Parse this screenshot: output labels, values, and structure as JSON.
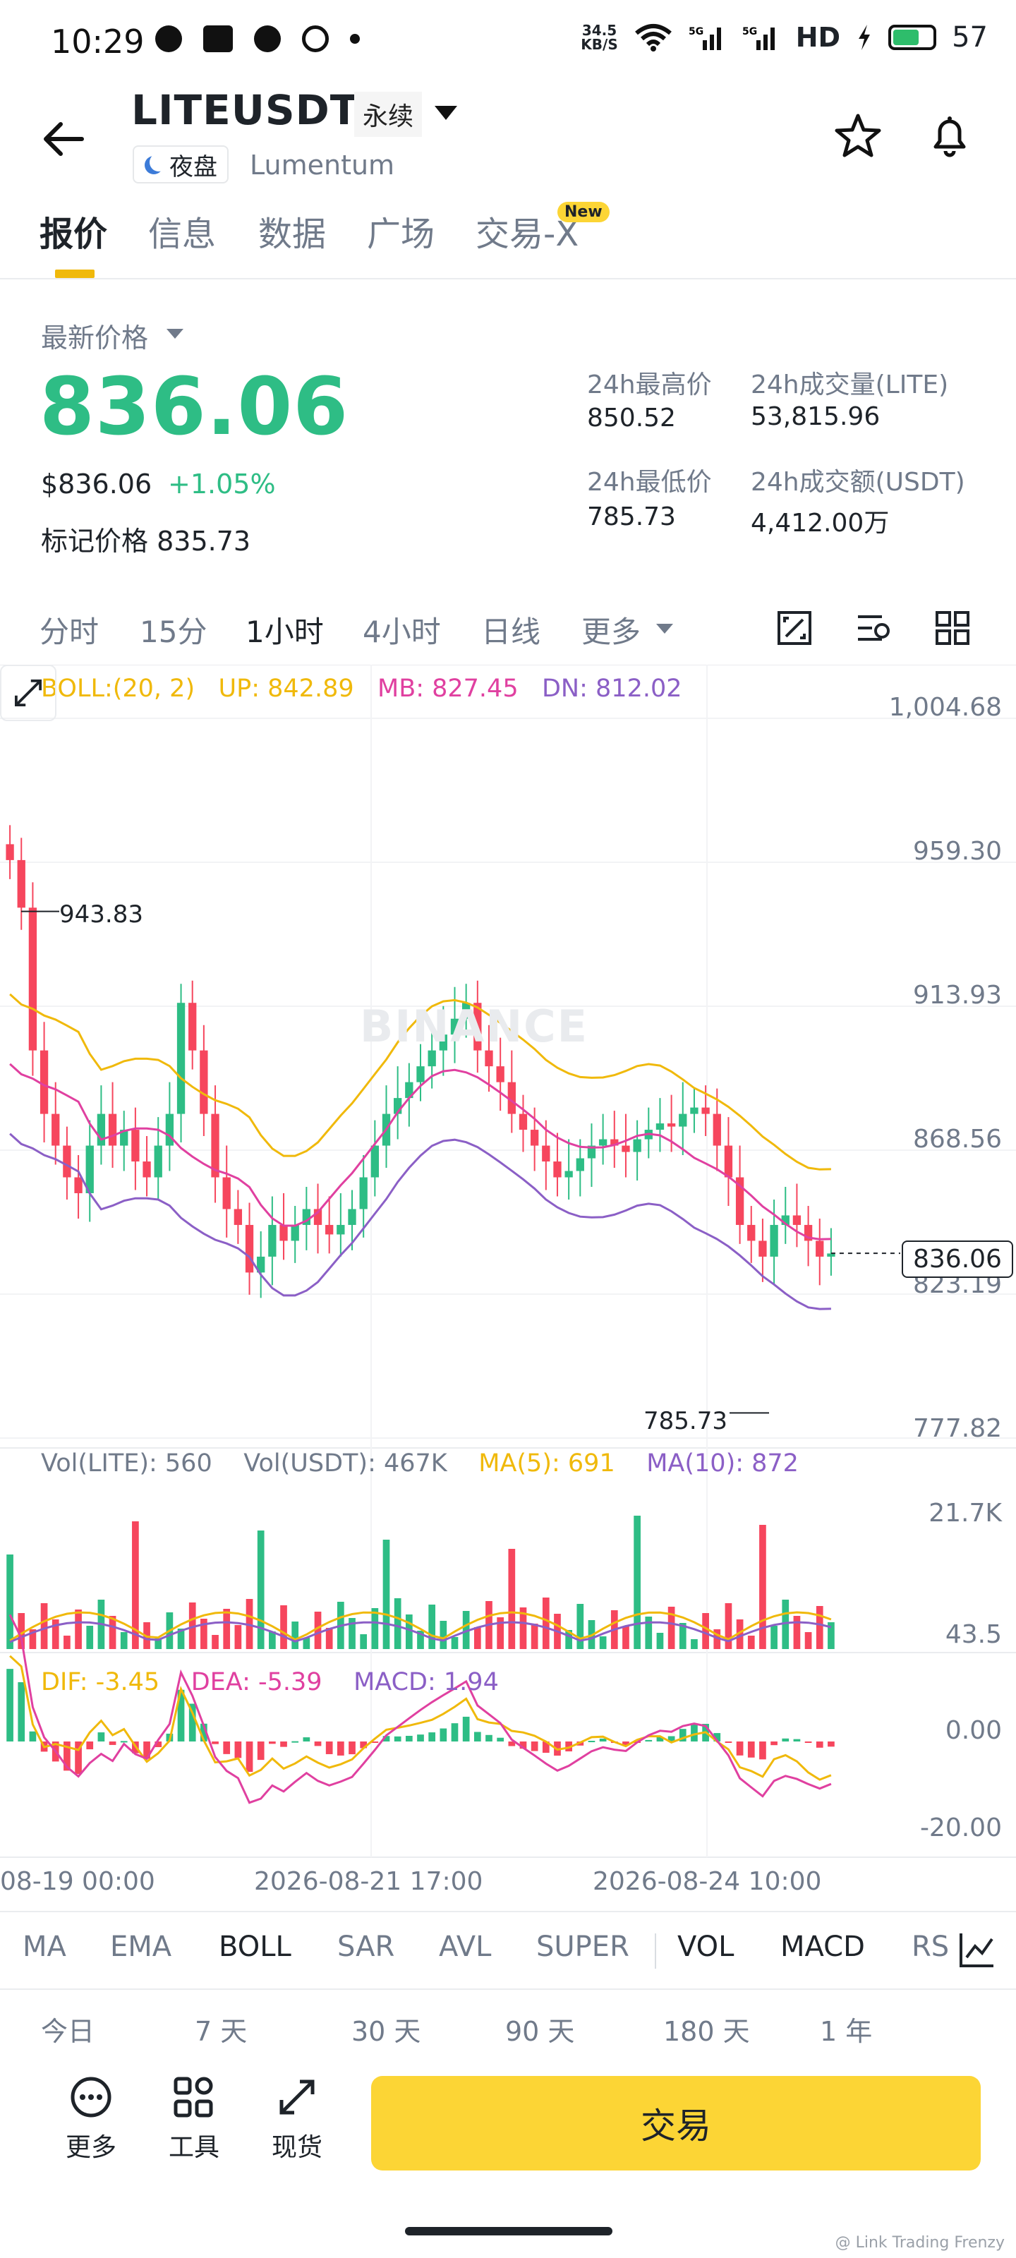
{
  "status_bar": {
    "time": "10:29",
    "net_speed_top": "34.5",
    "net_speed_unit": "KB/S",
    "battery": "57"
  },
  "header": {
    "symbol": "LITEUSDT",
    "contract_type": "永续",
    "session_tag": "夜盘",
    "company": "Lumentum"
  },
  "tabs": [
    {
      "label": "报价",
      "active": true
    },
    {
      "label": "信息",
      "active": false
    },
    {
      "label": "数据",
      "active": false
    },
    {
      "label": "广场",
      "active": false
    },
    {
      "label": "交易-X",
      "active": false
    }
  ],
  "new_badge": "New",
  "price": {
    "latest_label": "最新价格",
    "last": "836.06",
    "usd": "$836.06",
    "change": "+1.05%",
    "mark_label": "标记价格",
    "mark": "835.73"
  },
  "stats": {
    "high_label": "24h最高价",
    "high": "850.52",
    "low_label": "24h最低价",
    "low": "785.73",
    "vol_base_label": "24h成交量(LITE)",
    "vol_base": "53,815.96",
    "vol_quote_label": "24h成交额(USDT)",
    "vol_quote": "4,412.00万"
  },
  "intervals": [
    {
      "label": "分时",
      "active": false
    },
    {
      "label": "15分",
      "active": false
    },
    {
      "label": "1小时",
      "active": true
    },
    {
      "label": "4小时",
      "active": false
    },
    {
      "label": "日线",
      "active": false
    },
    {
      "label": "更多",
      "active": false
    }
  ],
  "chart": {
    "watermark": "BINANCE",
    "boll_legend": {
      "name": "BOLL:(20, 2)",
      "up": "UP: 842.89",
      "mb": "MB: 827.45",
      "dn": "DN: 812.02"
    },
    "price_axis": [
      "1,004.68",
      "959.30",
      "913.93",
      "868.56",
      "823.19",
      "777.82"
    ],
    "high_marker": "943.83",
    "low_marker": "785.73",
    "current_price_tag": "836.06",
    "vol_legend": {
      "base": "Vol(LITE): 560",
      "quote": "Vol(USDT): 467K",
      "ma5": "MA(5): 691",
      "ma10": "MA(10): 872"
    },
    "vol_axis": [
      "21.7K",
      "43.5"
    ],
    "macd_legend": {
      "dif": "DIF: -3.45",
      "dea": "DEA: -5.39",
      "macd": "MACD: 1.94"
    },
    "macd_axis": [
      "0.00",
      "-20.00"
    ],
    "time_axis": [
      "08-19 00:00",
      "2026-08-21 17:00",
      "2026-08-24 10:00"
    ],
    "colors": {
      "up": "#2ebd85",
      "down": "#f6465d",
      "boll_up": "#f0b90b",
      "boll_mb": "#e040a0",
      "boll_dn": "#8b5fc6"
    }
  },
  "chart_data": {
    "type": "candlestick",
    "price_ylim": [
      777.82,
      1004.68
    ],
    "closes": [
      960,
      945,
      900,
      880,
      870,
      860,
      855,
      870,
      880,
      870,
      875,
      865,
      860,
      870,
      880,
      915,
      900,
      880,
      860,
      850,
      845,
      830,
      835,
      845,
      840,
      845,
      850,
      845,
      842,
      845,
      850,
      860,
      870,
      880,
      885,
      890,
      895,
      900,
      905,
      910,
      915,
      900,
      895,
      890,
      880,
      875,
      870,
      865,
      860,
      862,
      866,
      870,
      872,
      870,
      868,
      872,
      875,
      877,
      876,
      880,
      882,
      880,
      870,
      860,
      845,
      840,
      835,
      845,
      848,
      845,
      840,
      835,
      836
    ],
    "volume_axis": [
      "21.7K",
      "43.5"
    ]
  },
  "indicators": [
    {
      "label": "MA",
      "active": false
    },
    {
      "label": "EMA",
      "active": false
    },
    {
      "label": "BOLL",
      "active": true
    },
    {
      "label": "SAR",
      "active": false
    },
    {
      "label": "AVL",
      "active": false
    },
    {
      "label": "SUPER",
      "active": false
    },
    {
      "label": "VOL",
      "active": true
    },
    {
      "label": "MACD",
      "active": true
    },
    {
      "label": "RS",
      "active": false
    }
  ],
  "ranges": [
    "今日",
    "7 天",
    "30 天",
    "90 天",
    "180 天",
    "1 年"
  ],
  "bottom": {
    "more": "更多",
    "tools": "工具",
    "spot": "现货",
    "trade": "交易"
  },
  "credit": "@ Link Trading Frenzy"
}
